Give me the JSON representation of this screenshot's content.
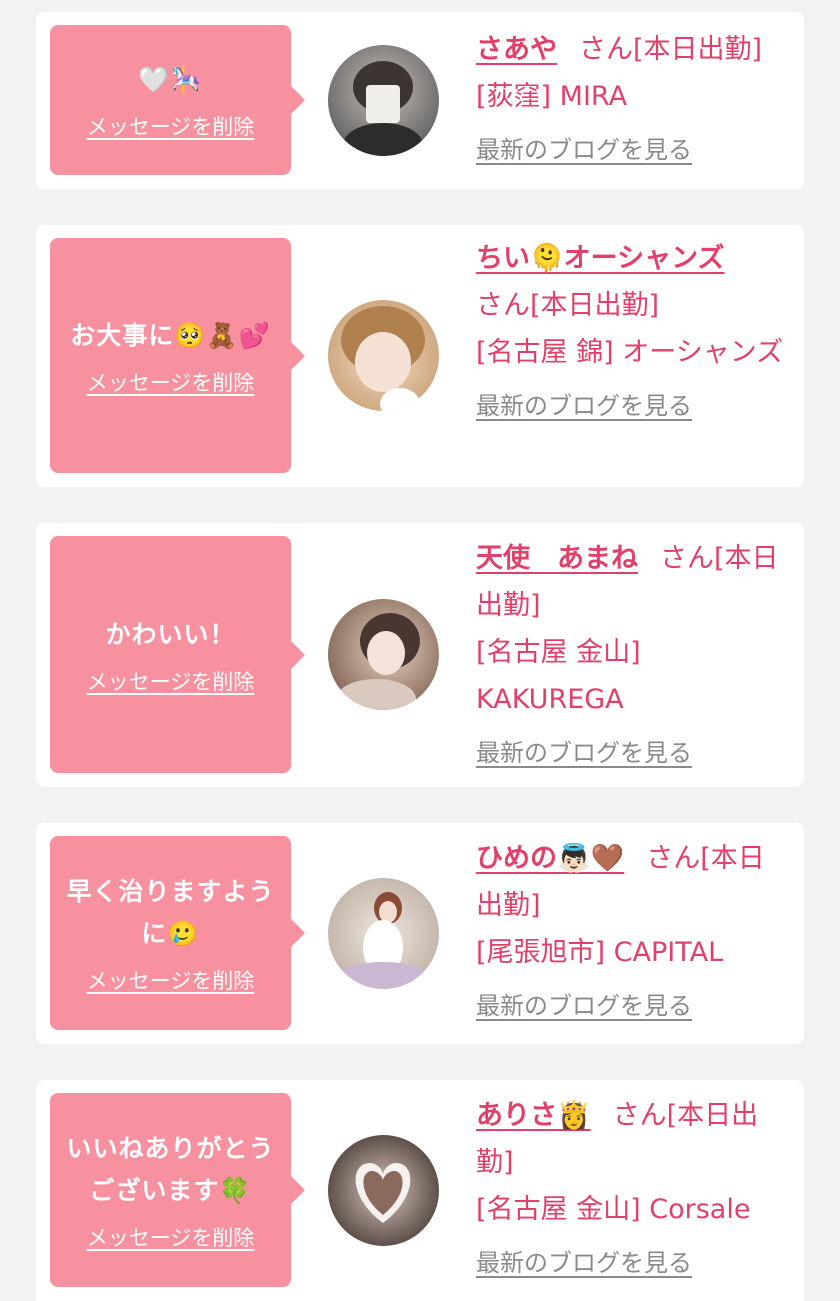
{
  "messages": [
    {
      "message": "🤍🎠",
      "delete_label": "メッセージを削除",
      "name": "さあや",
      "suffix": "さん[本日出勤]",
      "shop": "[荻窪] MIRA",
      "blog_label": "最新のブログを見る",
      "avatar_colors": [
        "#5a5a5e",
        "#c9c0b6"
      ]
    },
    {
      "message": "お大事に🥺🧸💕",
      "delete_label": "メッセージを削除",
      "name": "ちい🫠オーシャンズ",
      "suffix": "さん[本日出勤]",
      "shop": "[名古屋 錦] オーシャンズ",
      "blog_label": "最新のブログを見る",
      "avatar_colors": [
        "#c49a6c",
        "#f3dcc7"
      ]
    },
    {
      "message": "かわいい！",
      "delete_label": "メッセージを削除",
      "name": "天使　あまね",
      "suffix": "さん[本日出勤]",
      "shop": "[名古屋 金山] KAKUREGA",
      "blog_label": "最新のブログを見る",
      "avatar_colors": [
        "#7b5e4f",
        "#e8d1c0"
      ]
    },
    {
      "message": "早く治りますように🥲",
      "delete_label": "メッセージを削除",
      "name": "ひめの👼🏻🤎",
      "suffix": "さん[本日出勤]",
      "shop": "[尾張旭市] CAPITAL",
      "blog_label": "最新のブログを見る",
      "avatar_colors": [
        "#b9a99c",
        "#efe7e0"
      ]
    },
    {
      "message": "いいねありがとうございます🍀",
      "delete_label": "メッセージを削除",
      "name": "ありさ👸",
      "suffix": "さん[本日出勤]",
      "shop": "[名古屋 金山] Corsale",
      "blog_label": "最新のブログを見る",
      "avatar_colors": [
        "#3a2c28",
        "#d8c6bd"
      ]
    }
  ],
  "colors": {
    "background": "#f2f2f2",
    "bubble": "#f7909f",
    "accent": "#e0406a",
    "muted": "#8a8a8a"
  }
}
